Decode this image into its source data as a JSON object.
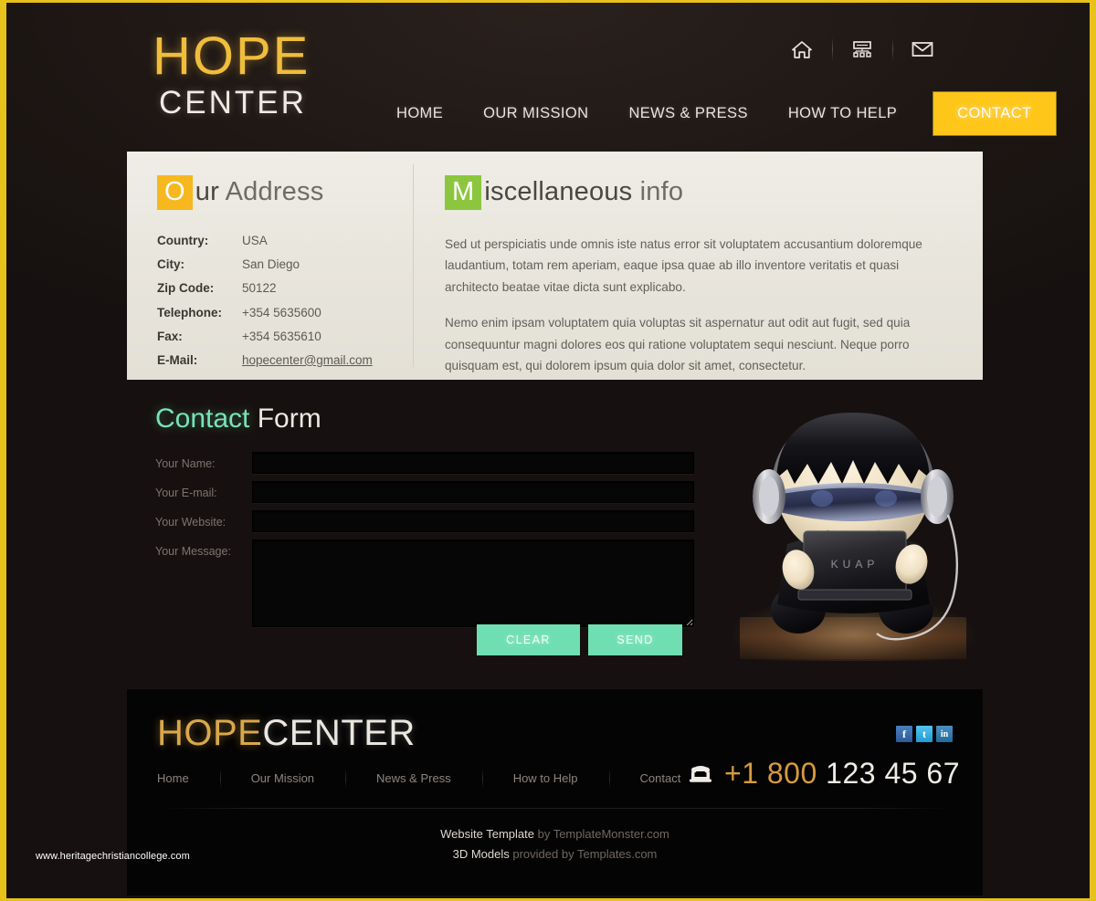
{
  "brand": {
    "logo_top": "HOPE",
    "logo_bottom": "CENTER",
    "footer_logo_part1": "HOPE",
    "footer_logo_part2": "CENTER"
  },
  "header": {
    "icons": [
      {
        "name": "home-icon",
        "label": "Home"
      },
      {
        "name": "sitemap-icon",
        "label": "Sitemap"
      },
      {
        "name": "mail-icon",
        "label": "Contact us"
      }
    ],
    "nav": [
      {
        "label": "HOME",
        "active": false
      },
      {
        "label": "OUR MISSION",
        "active": false
      },
      {
        "label": "NEWS & PRESS",
        "active": false
      },
      {
        "label": "HOW TO HELP",
        "active": false
      },
      {
        "label": "CONTACT",
        "active": true
      }
    ]
  },
  "address": {
    "title_cap": "O",
    "title_rest": "ur",
    "title_suffix": "Address",
    "rows": [
      {
        "label": "Country:",
        "value": "USA",
        "link": false
      },
      {
        "label": "City:",
        "value": "San Diego",
        "link": false
      },
      {
        "label": "Zip Code:",
        "value": "50122",
        "link": false
      },
      {
        "label": "Telephone:",
        "value": "+354 5635600",
        "link": false
      },
      {
        "label": "Fax:",
        "value": "+354 5635610",
        "link": false
      },
      {
        "label": "E-Mail:",
        "value": "hopecenter@gmail.com",
        "link": true
      }
    ]
  },
  "misc": {
    "title_cap": "M",
    "title_rest": "iscellaneous",
    "title_suffix": "info",
    "paragraphs": [
      "Sed ut perspiciatis unde omnis iste natus error sit voluptatem accusantium doloremque laudantium, totam rem aperiam, eaque ipsa quae ab illo inventore veritatis et quasi architecto beatae vitae dicta sunt explicabo.",
      "Nemo enim ipsam voluptatem quia voluptas sit aspernatur aut odit aut fugit, sed quia consequuntur magni dolores eos qui ratione voluptatem sequi nesciunt. Neque porro quisquam est, qui dolorem ipsum quia dolor sit amet, consectetur."
    ]
  },
  "contact_form": {
    "title_part1": "Contact",
    "title_part2": "Form",
    "fields": [
      {
        "label": "Your Name:",
        "value": "",
        "placeholder": "",
        "type": "text"
      },
      {
        "label": "Your E-mail:",
        "value": "",
        "placeholder": "",
        "type": "text"
      },
      {
        "label": "Your Website:",
        "value": "",
        "placeholder": "",
        "type": "text"
      },
      {
        "label": "Your Message:",
        "value": "",
        "placeholder": "",
        "type": "textarea"
      }
    ],
    "clear_label": "CLEAR",
    "send_label": "SEND"
  },
  "illustration": {
    "name": "3d-character-with-laptop",
    "laptop_text": "KUAP"
  },
  "footer": {
    "nav": [
      {
        "label": "Home"
      },
      {
        "label": "Our Mission"
      },
      {
        "label": "News & Press"
      },
      {
        "label": "How to Help"
      },
      {
        "label": "Contact"
      }
    ],
    "social": [
      {
        "name": "facebook-icon",
        "glyph": "f"
      },
      {
        "name": "twitter-icon",
        "glyph": "t"
      },
      {
        "name": "linkedin-icon",
        "glyph": "in"
      }
    ],
    "phone_prefix": "+1 800",
    "phone_rest": "123 45 67",
    "credit_line1_strong": "Website Template",
    "credit_line1_dim": "by TemplateMonster.com",
    "credit_line2_strong": "3D Models",
    "credit_line2_dim": "provided by Templates.com"
  },
  "watermark": "www.heritagechristiancollege.com",
  "colors": {
    "accent_yellow": "#ffc61a",
    "border_gold": "#e8c11a",
    "logo_gold": "#f0bd3c",
    "panel_bg": "#eae7df",
    "mint": "#6fdfb1",
    "green_cap": "#8cc63e",
    "orange_cap": "#f7b71f",
    "page_bg": "#1c1614",
    "footer_bg": "#050404"
  }
}
